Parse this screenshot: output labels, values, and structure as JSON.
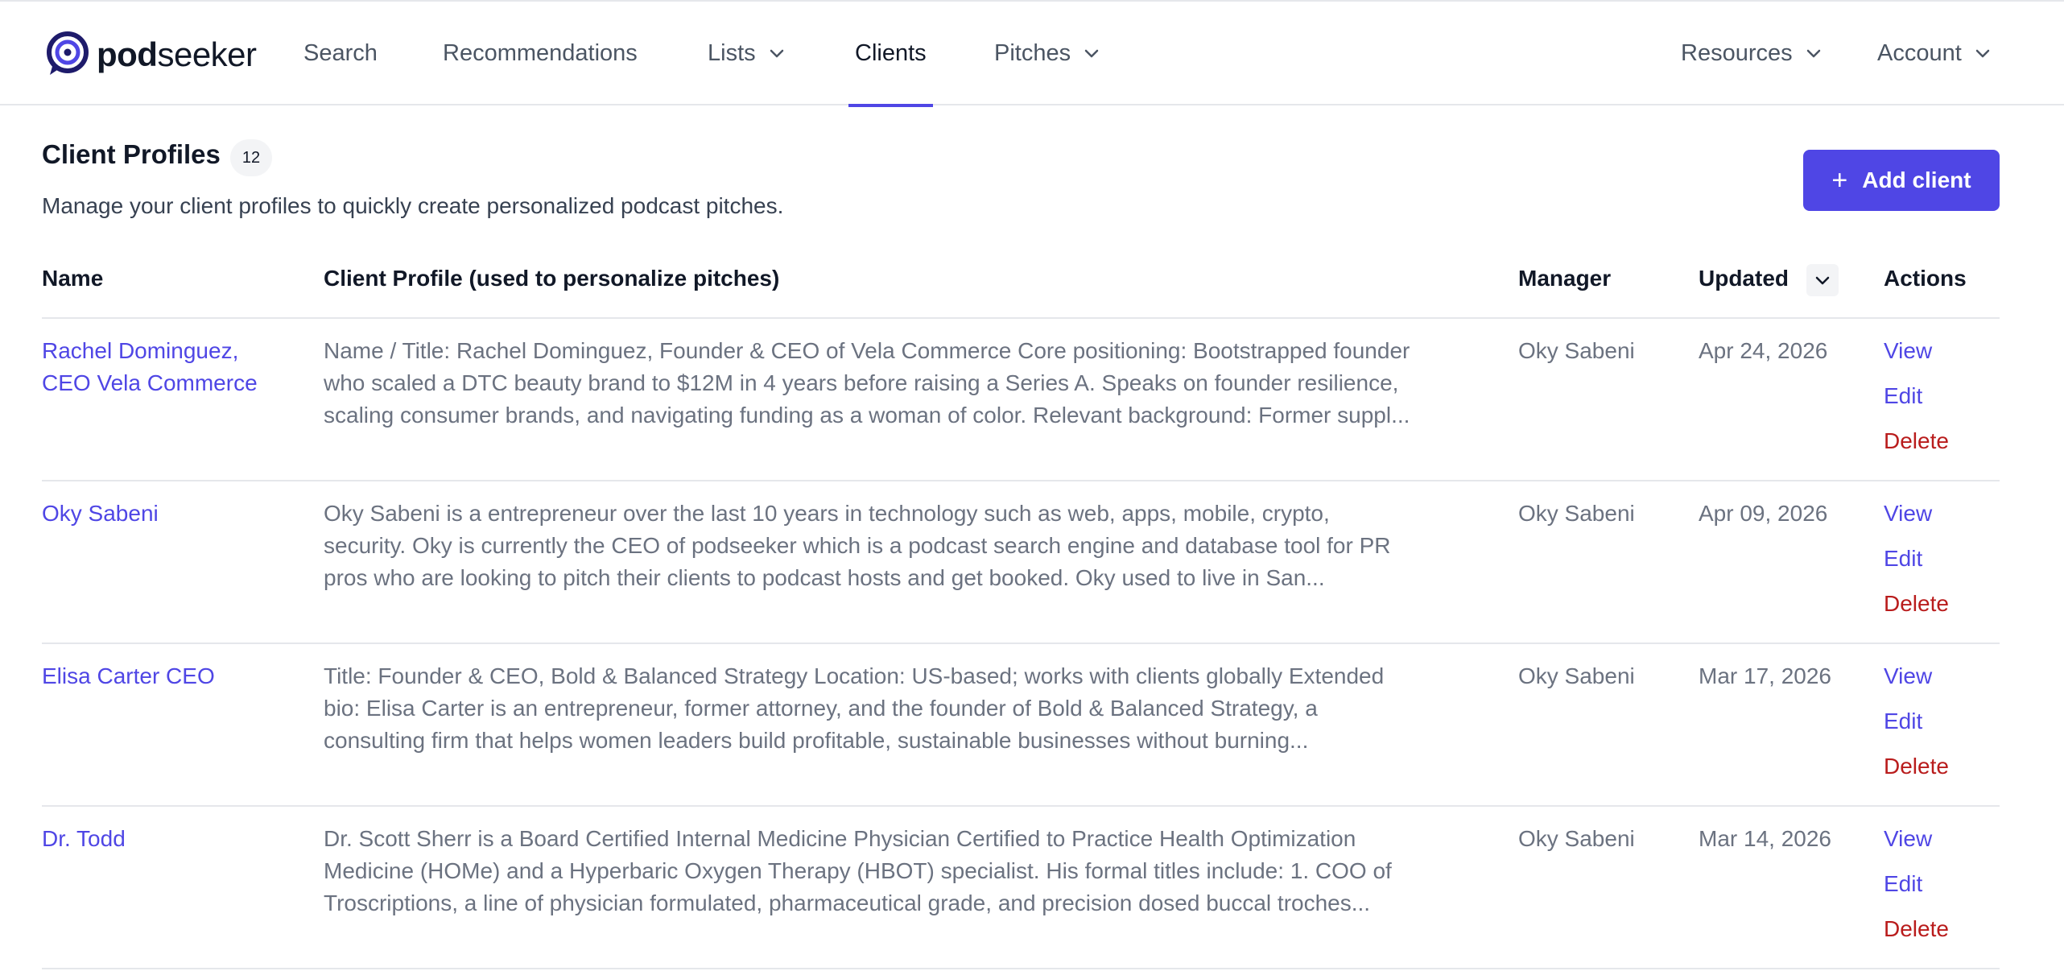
{
  "brand": {
    "name_bold": "pod",
    "name_light": "seeker",
    "accent": "#4f46e5",
    "danger": "#b91c1c"
  },
  "nav": {
    "items": [
      {
        "label": "Search"
      },
      {
        "label": "Recommendations"
      },
      {
        "label": "Lists",
        "dropdown": true
      },
      {
        "label": "Clients",
        "active": true
      },
      {
        "label": "Pitches",
        "dropdown": true
      }
    ],
    "right": [
      {
        "label": "Resources",
        "dropdown": true
      },
      {
        "label": "Account",
        "dropdown": true
      }
    ]
  },
  "header": {
    "title": "Client Profiles",
    "count": "12",
    "subtitle": "Manage your client profiles to quickly create personalized podcast pitches.",
    "add_button": "Add client"
  },
  "table": {
    "columns": {
      "name": "Name",
      "profile": "Client Profile (used to personalize pitches)",
      "manager": "Manager",
      "updated": "Updated",
      "actions": "Actions"
    },
    "action_labels": {
      "view": "View",
      "edit": "Edit",
      "delete": "Delete"
    },
    "rows": [
      {
        "name": "Rachel Dominguez,\nCEO Vela Commerce",
        "profile": "Name / Title: Rachel Dominguez, Founder & CEO of Vela Commerce Core positioning: Bootstrapped founder\nwho scaled a DTC beauty brand to $12M in 4 years before raising a Series A. Speaks on founder resilience,\nscaling consumer brands, and navigating funding as a woman of color. Relevant background: Former suppl...",
        "manager": "Oky Sabeni",
        "updated": "Apr 24, 2026"
      },
      {
        "name": "Oky Sabeni",
        "profile": "Oky Sabeni is a entrepreneur over the last 10 years in technology such as web, apps, mobile, crypto,\nsecurity. Oky is currently the CEO of podseeker which is a podcast search engine and database tool for PR\npros who are looking to pitch their clients to podcast hosts and get booked. Oky used to live in San...",
        "manager": "Oky Sabeni",
        "updated": "Apr 09, 2026"
      },
      {
        "name": "Elisa Carter CEO",
        "profile": "Title: Founder & CEO, Bold & Balanced Strategy Location: US-based; works with clients globally Extended\nbio: Elisa Carter is an entrepreneur, former attorney, and the founder of Bold & Balanced Strategy, a\nconsulting firm that helps women leaders build profitable, sustainable businesses without burning...",
        "manager": "Oky Sabeni",
        "updated": "Mar 17, 2026"
      },
      {
        "name": "Dr. Todd",
        "profile": "Dr. Scott Sherr is a Board Certified Internal Medicine Physician Certified to Practice Health Optimization\nMedicine (HOMe) and a Hyperbaric Oxygen Therapy (HBOT) specialist. His formal titles include: 1. COO of\nTroscriptions, a line of physician formulated, pharmaceutical grade, and precision dosed buccal troches...",
        "manager": "Oky Sabeni",
        "updated": "Mar 14, 2026"
      }
    ]
  }
}
